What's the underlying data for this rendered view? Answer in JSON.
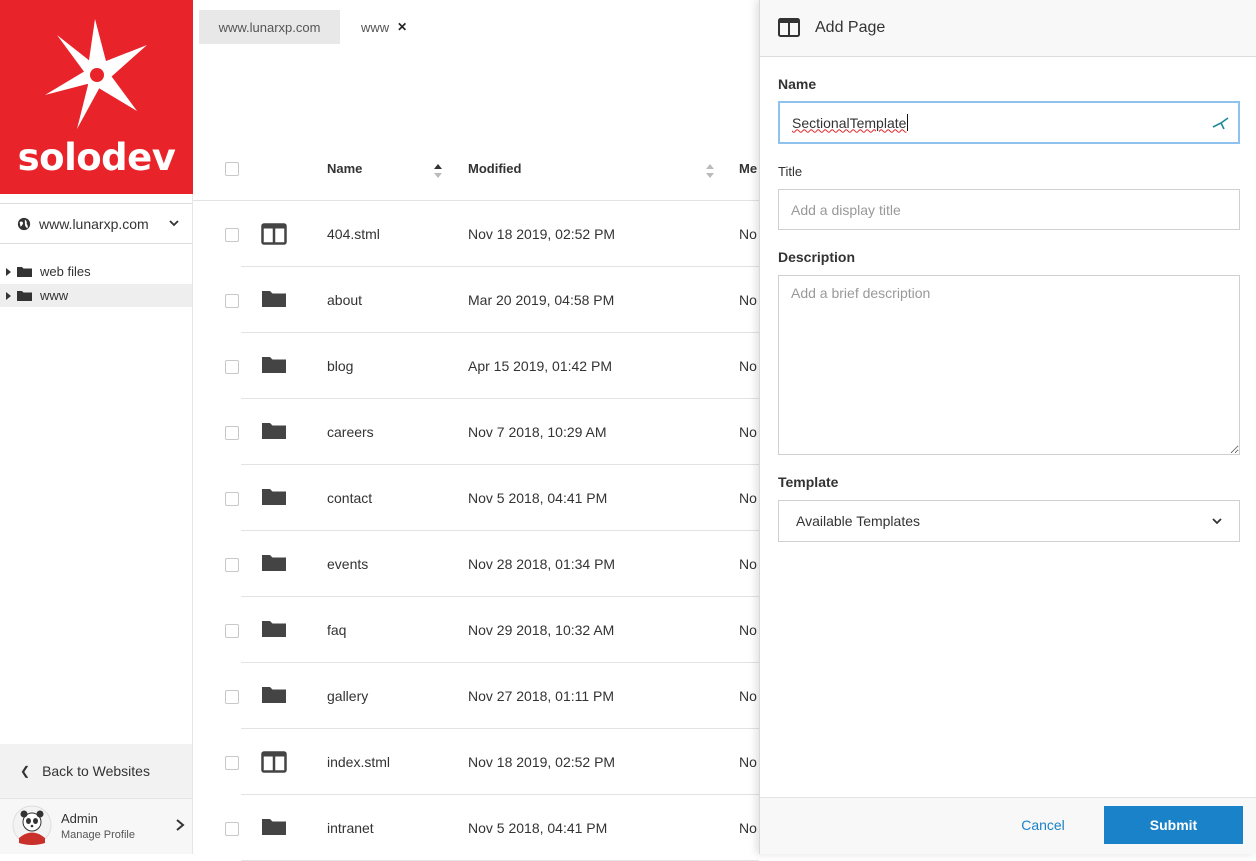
{
  "brand": {
    "name": "solodev",
    "color": "#e8232a"
  },
  "sidebar": {
    "site_selector": "www.lunarxp.com",
    "tree": [
      {
        "label": "web files",
        "icon": "folder-icon"
      },
      {
        "label": "www",
        "icon": "folder-icon"
      }
    ],
    "back_label": "Back to Websites",
    "profile": {
      "name": "Admin",
      "subtitle": "Manage Profile"
    }
  },
  "tabs": [
    {
      "label": "www.lunarxp.com"
    },
    {
      "label": "www",
      "close": "✕"
    }
  ],
  "table": {
    "columns": {
      "name": "Name",
      "modified": "Modified",
      "meta": "Me"
    },
    "rows": [
      {
        "name": "404.stml",
        "modified": "Nov 18 2019, 02:52 PM",
        "meta": "No",
        "icon": "page-template-icon"
      },
      {
        "name": "about",
        "modified": "Mar 20 2019, 04:58 PM",
        "meta": "No",
        "icon": "folder-icon"
      },
      {
        "name": "blog",
        "modified": "Apr 15 2019, 01:42 PM",
        "meta": "No",
        "icon": "folder-icon"
      },
      {
        "name": "careers",
        "modified": "Nov 7 2018, 10:29 AM",
        "meta": "No",
        "icon": "folder-icon"
      },
      {
        "name": "contact",
        "modified": "Nov 5 2018, 04:41 PM",
        "meta": "No",
        "icon": "folder-icon"
      },
      {
        "name": "events",
        "modified": "Nov 28 2018, 01:34 PM",
        "meta": "No",
        "icon": "folder-icon"
      },
      {
        "name": "faq",
        "modified": "Nov 29 2018, 10:32 AM",
        "meta": "No",
        "icon": "folder-icon"
      },
      {
        "name": "gallery",
        "modified": "Nov 27 2018, 01:11 PM",
        "meta": "No",
        "icon": "folder-icon"
      },
      {
        "name": "index.stml",
        "modified": "Nov 18 2019, 02:52 PM",
        "meta": "No",
        "icon": "page-template-icon"
      },
      {
        "name": "intranet",
        "modified": "Nov 5 2018, 04:41 PM",
        "meta": "No",
        "icon": "folder-icon"
      }
    ]
  },
  "panel": {
    "title": "Add Page",
    "name_label": "Name",
    "name_value": "SectionalTemplate",
    "title_label": "Title",
    "title_placeholder": "Add a display title",
    "description_label": "Description",
    "description_placeholder": "Add a brief description",
    "template_label": "Template",
    "template_value": "Available Templates",
    "cancel_label": "Cancel",
    "submit_label": "Submit",
    "accent_color": "#1a82c9"
  }
}
